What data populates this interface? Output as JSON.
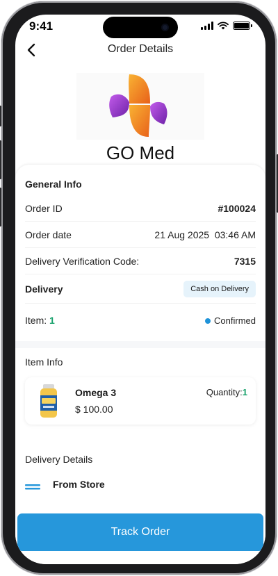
{
  "status_bar": {
    "time": "9:41"
  },
  "header": {
    "title": "Order Details",
    "back_icon": "chevron-left-icon"
  },
  "brand": {
    "name": "GO Med",
    "logo_colors": [
      "#F6A21E",
      "#E8611A",
      "#7A2FB0",
      "#B24CE0"
    ]
  },
  "general_info": {
    "title": "General Info",
    "order_id_label": "Order ID",
    "order_id_value": "#100024",
    "order_date_label": "Order date",
    "order_date_value": "21 Aug 2025  03:46 AM",
    "verification_label": "Delivery Verification Code:",
    "verification_value": "7315",
    "delivery_label": "Delivery",
    "delivery_badge": "Cash on Delivery",
    "item_label": "Item:",
    "item_count": "1",
    "status": "Confirmed"
  },
  "item_info": {
    "title": "Item Info",
    "items": [
      {
        "name": "Omega 3",
        "price": "$ 100.00",
        "quantity_label": "Quantity:",
        "quantity": "1"
      }
    ]
  },
  "delivery_details": {
    "title": "Delivery Details",
    "from_label": "From Store"
  },
  "footer": {
    "track_button": "Track Order"
  },
  "colors": {
    "accent": "#2697DB",
    "confirmed_dot": "#1F93D9",
    "item_count": "#17A16B",
    "badge_bg": "#E6F3FB"
  }
}
